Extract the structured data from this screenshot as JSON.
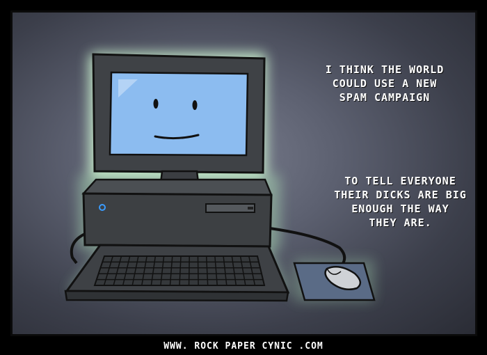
{
  "panel": {
    "caption_1": "I THINK THE WORLD\nCOULD USE A NEW\nSPAM CAMPAIGN",
    "caption_2": "TO TELL EVERYONE\nTHEIR DICKS ARE BIG\nENOUGH THE WAY\nTHEY ARE."
  },
  "footer": {
    "url": "WWW. ROCK PAPER CYNIC .COM"
  },
  "colors": {
    "screen": "#8cbcf0",
    "glow": "#c8ffd0",
    "body": "#555a5e",
    "background": "#4a4d5a"
  },
  "icons": {
    "power": "power-icon"
  }
}
